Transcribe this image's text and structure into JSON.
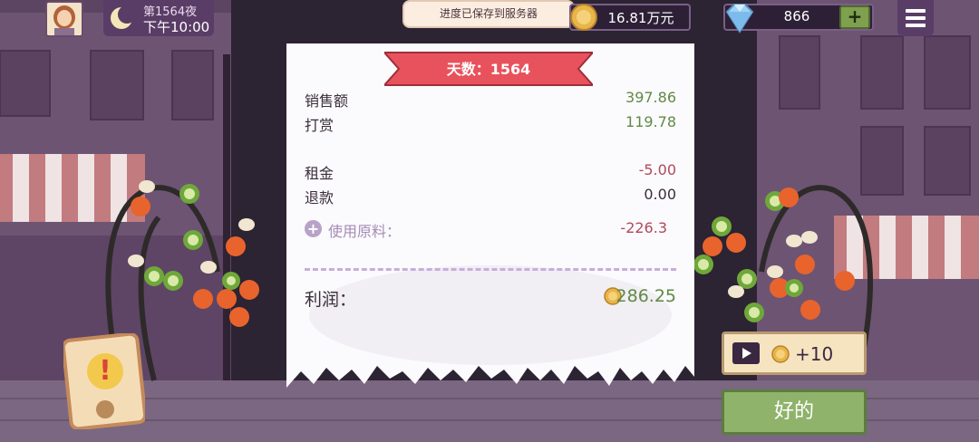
{
  "hud": {
    "day_label": "第1564夜",
    "time_label": "下午10:00",
    "toast": "进度已保存到服务器",
    "money": "16.81万元",
    "gems": "866",
    "gem_add": "+"
  },
  "receipt": {
    "title": "天数：1564",
    "rows": [
      {
        "label": "销售额",
        "value": "397.86"
      },
      {
        "label": "打赏",
        "value": "119.78"
      },
      {
        "label": "租金",
        "value": "-5.00"
      },
      {
        "label": "退款",
        "value": "0.00"
      }
    ],
    "materials": {
      "icon": "+",
      "label": "使用原料：",
      "value": "-226.3"
    },
    "profit": {
      "label": "利润：",
      "value": "286.25"
    }
  },
  "buttons": {
    "ad_reward": "+10",
    "ok": "好的",
    "alert_icon": "!"
  },
  "colors": {
    "positive": "#5f8a46",
    "negative": "#b04a5c",
    "ribbon": "#e8525c",
    "ok_button": "#8fb36a"
  }
}
